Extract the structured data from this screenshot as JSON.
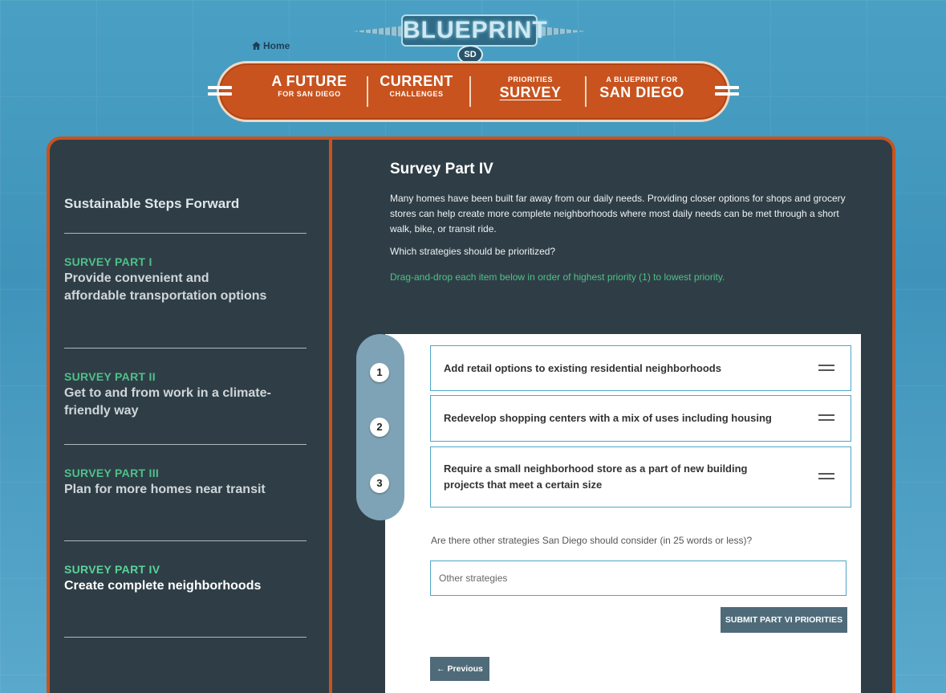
{
  "header": {
    "logo_text": "BLUEPRINT",
    "logo_badge": "SD",
    "home_label": "Home",
    "nav": [
      {
        "big": "A FUTURE",
        "small": "FOR SAN DIEGO",
        "active": false
      },
      {
        "big": "CURRENT",
        "small": "CHALLENGES",
        "active": false
      },
      {
        "small": "PRIORITIES",
        "big": "SURVEY",
        "active": true
      },
      {
        "small": "A BLUEPRINT FOR",
        "big": "SAN DIEGO",
        "active": false
      }
    ]
  },
  "sidebar": {
    "heading": "Sustainable Steps Forward",
    "parts": [
      {
        "tag": "SURVEY PART I",
        "title": "Provide convenient and affordable transportation options"
      },
      {
        "tag": "SURVEY PART II",
        "title": "Get to and from work in a climate-friendly way"
      },
      {
        "tag": "SURVEY PART III",
        "title": "Plan for more homes near transit"
      },
      {
        "tag": "SURVEY PART IV",
        "title": "Create complete neighborhoods"
      }
    ]
  },
  "main": {
    "title": "Survey Part IV",
    "intro": "Many homes have been built far away from our daily needs. Providing closer options for shops and grocery stores can help create more complete neighborhoods where most daily needs can be met through a short walk, bike, or transit ride.",
    "question": "Which strategies should be prioritized?",
    "instruction": "Drag-and-drop each item below in order of highest priority (1) to lowest priority.",
    "ranks": [
      "1",
      "2",
      "3"
    ],
    "items": [
      "Add retail options to existing residential neighborhoods",
      "Redevelop shopping centers with a mix of uses including housing",
      "Require a small neighborhood store as a part of new building projects that meet a certain size"
    ],
    "other_question": "Are there other strategies San Diego should consider (in 25 words or less)?",
    "other_placeholder": "Other strategies",
    "submit_label": "SUBMIT PART VI PRIORITIES",
    "previous_label": "← Previous"
  },
  "colors": {
    "accent_orange": "#c8531e",
    "panel_dark": "#2f3e46",
    "survey_green": "#4fc08a",
    "item_border": "#4da6c7",
    "button": "#4f6b7a"
  }
}
